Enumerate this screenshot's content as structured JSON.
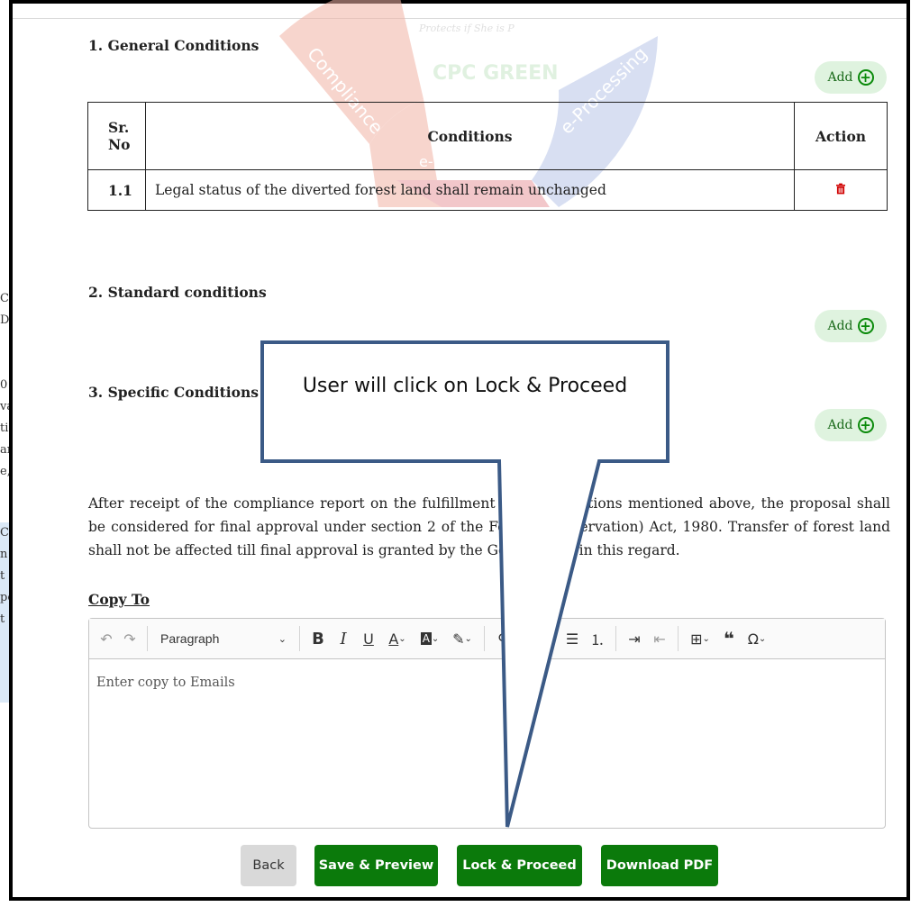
{
  "sections": {
    "general": {
      "title": "1. General Conditions",
      "add_label": "Add",
      "table": {
        "headers": {
          "sr": "Sr. No",
          "conditions": "Conditions",
          "action": "Action"
        },
        "rows": [
          {
            "sr": "1.1",
            "condition": "Legal status of the diverted forest land shall remain unchanged"
          }
        ]
      }
    },
    "standard": {
      "title": "2. Standard conditions",
      "add_label": "Add"
    },
    "specific": {
      "title": "3. Specific Conditions",
      "add_label": "Add"
    }
  },
  "paragraph": "After receipt of the compliance report on the fulfillment of the conditions mentioned above, the proposal shall be considered for final approval under section 2 of the Forest (Conservation) Act, 1980. Transfer of forest land shall not be affected till final approval is granted by the Government in this regard.",
  "copy_to": {
    "label": "Copy To",
    "toolbar": {
      "paragraph_select": "Paragraph"
    },
    "placeholder": "Enter copy to Emails"
  },
  "buttons": {
    "back": "Back",
    "save_preview": "Save & Preview",
    "lock_proceed": "Lock & Proceed",
    "download_pdf": "Download PDF"
  },
  "callout": {
    "text": "User will click on Lock & Proceed"
  },
  "watermark": {
    "ring_text": "CPC GREEN",
    "segments": [
      "Compliance",
      "e-Processing",
      "e-payments"
    ],
    "tagline": "Protects if She is P"
  },
  "colors": {
    "accent_green": "#0b7a0b",
    "add_bg": "#dff3df",
    "delete_red": "#d00000",
    "callout_border": "#3b5a86"
  },
  "background_fragments": {
    "left_text": [
      "C",
      "D",
      "0",
      "va",
      "tic",
      "an",
      "e,",
      "C",
      "n",
      "t",
      "po",
      "t"
    ]
  }
}
